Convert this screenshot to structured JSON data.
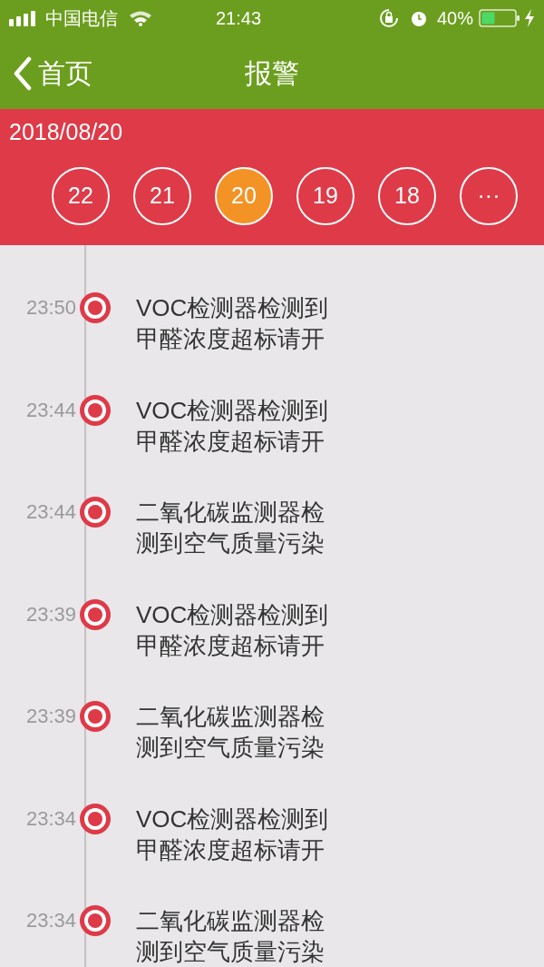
{
  "status_bar": {
    "carrier": "中国电信",
    "time": "21:43",
    "battery": "40%"
  },
  "nav": {
    "back": "首页",
    "title": "报警"
  },
  "date_bar": {
    "date": "2018/08/20",
    "days": [
      {
        "label": "22",
        "selected": false
      },
      {
        "label": "21",
        "selected": false
      },
      {
        "label": "20",
        "selected": true
      },
      {
        "label": "19",
        "selected": false
      },
      {
        "label": "18",
        "selected": false
      },
      {
        "label": "···",
        "selected": false
      }
    ]
  },
  "alarms": [
    {
      "time": "23:50",
      "lines": [
        "VOC检测器检测到",
        "甲醛浓度超标请开"
      ]
    },
    {
      "time": "23:44",
      "lines": [
        "VOC检测器检测到",
        "甲醛浓度超标请开"
      ]
    },
    {
      "time": "23:44",
      "lines": [
        "二氧化碳监测器检",
        "测到空气质量污染"
      ]
    },
    {
      "time": "23:39",
      "lines": [
        "VOC检测器检测到",
        "甲醛浓度超标请开"
      ]
    },
    {
      "time": "23:39",
      "lines": [
        "二氧化碳监测器检",
        "测到空气质量污染"
      ]
    },
    {
      "time": "23:34",
      "lines": [
        "VOC检测器检测到",
        "甲醛浓度超标请开"
      ]
    },
    {
      "time": "23:34",
      "lines": [
        "二氧化碳监测器检",
        "测到空气质量污染"
      ]
    }
  ]
}
